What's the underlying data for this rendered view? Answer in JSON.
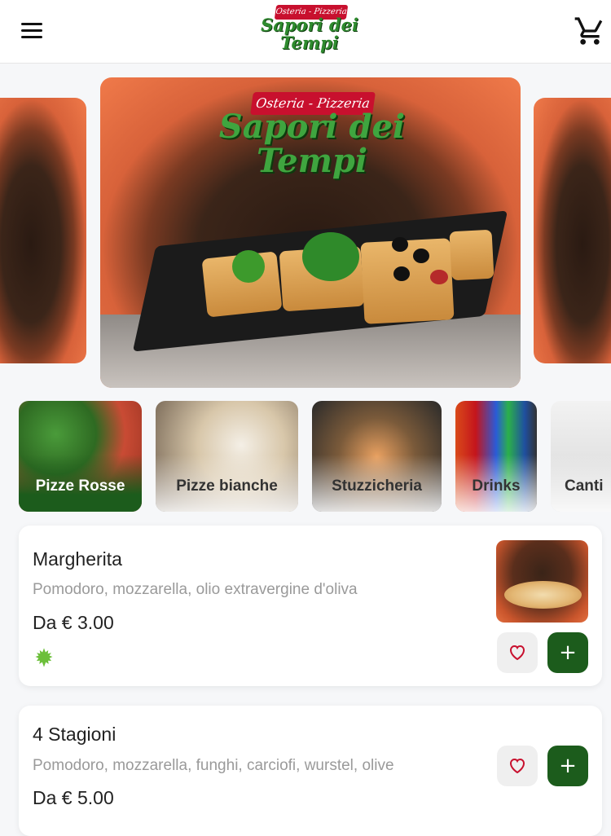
{
  "header": {
    "logo_banner": "Osteria - Pizzeria",
    "logo_script": "Sapori dei Tempi",
    "menu_icon": "hamburger-menu-icon",
    "cart_icon": "shopping-cart-icon"
  },
  "hero": {
    "banner": "Osteria - Pizzeria",
    "script": "Sapori dei Tempi"
  },
  "categories": [
    {
      "label": "Pizze Rosse",
      "active": true
    },
    {
      "label": "Pizze bianche",
      "active": false
    },
    {
      "label": "Stuzzicheria",
      "active": false
    },
    {
      "label": "Drinks",
      "active": false
    },
    {
      "label": "Canti",
      "active": false
    }
  ],
  "products": [
    {
      "name": "Margherita",
      "description": "Pomodoro, mozzarella, olio extravergine d'oliva",
      "price": "Da € 3.00",
      "has_leaf_icon": true,
      "has_image": true
    },
    {
      "name": "4 Stagioni",
      "description": "Pomodoro, mozzarella, funghi, carciofi, wurstel, olive",
      "price": "Da € 5.00",
      "has_leaf_icon": false,
      "has_image": false
    }
  ],
  "colors": {
    "brand_green": "#1c5c1c",
    "brand_red": "#c8102e",
    "heart_red": "#c8102e",
    "muted_text": "#9a9a9a"
  }
}
